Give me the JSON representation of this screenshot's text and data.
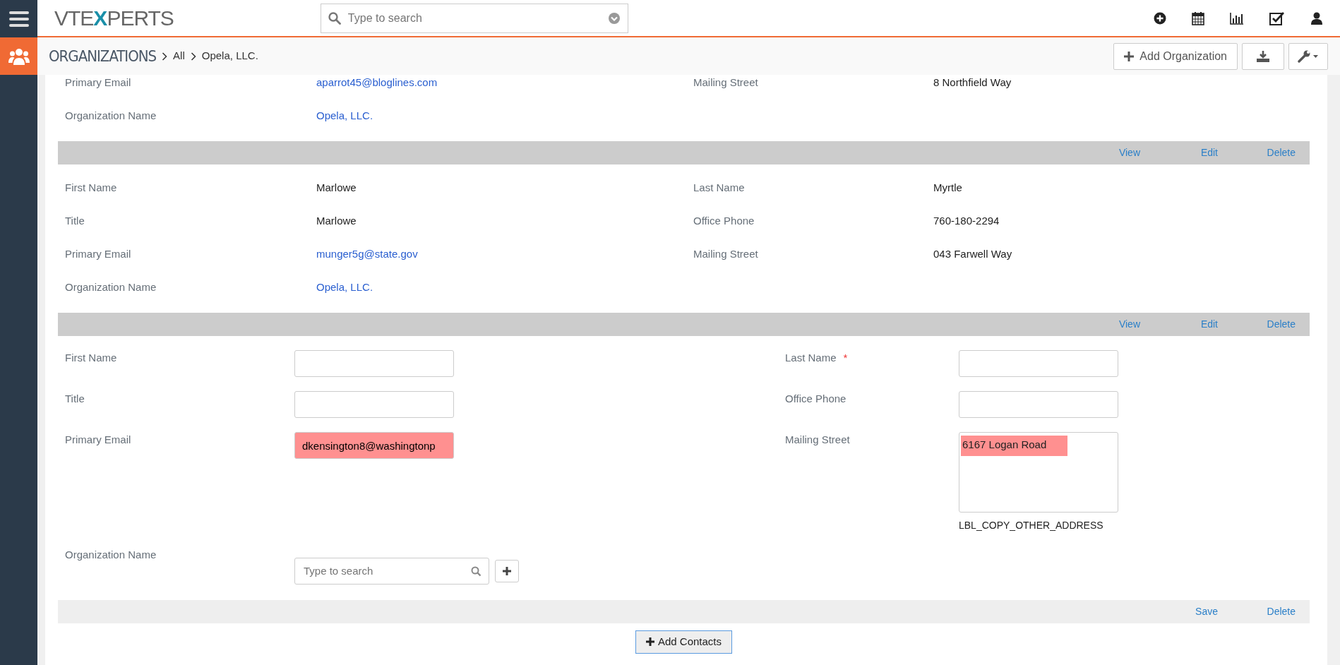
{
  "logo": [
    {
      "text": "VTE",
      "accent": false
    },
    {
      "text": "X",
      "accent": true
    },
    {
      "text": "PERTS",
      "accent": false
    }
  ],
  "search": {
    "placeholder": "Type to search"
  },
  "breadcrumb": {
    "module": "ORGANIZATIONS",
    "items": [
      "All",
      "Opela, LLC."
    ]
  },
  "toolbar": {
    "add_button": "Add Organization"
  },
  "records": [
    {
      "kind": "view",
      "fields": [
        {
          "label": "Primary Email",
          "value": "aparrot45@bloglines.com",
          "link": true
        },
        {
          "label": "Mailing Street",
          "value": "8 Northfield Way",
          "link": false
        },
        {
          "label": "Organization Name",
          "value": "Opela, LLC.",
          "link": true
        }
      ]
    },
    {
      "kind": "view",
      "actions": [
        "View",
        "Edit",
        "Delete"
      ],
      "fields": [
        {
          "label": "First Name",
          "value": "Marlowe",
          "link": false
        },
        {
          "label": "Last Name",
          "value": "Myrtle",
          "link": false
        },
        {
          "label": "Title",
          "value": "Marlowe",
          "link": false
        },
        {
          "label": "Office Phone",
          "value": "760-180-2294",
          "link": false
        },
        {
          "label": "Primary Email",
          "value": "munger5g@state.gov",
          "link": true
        },
        {
          "label": "Mailing Street",
          "value": "043 Farwell Way",
          "link": false
        },
        {
          "label": "Organization Name",
          "value": "Opela, LLC.",
          "link": true
        }
      ]
    },
    {
      "kind": "edit",
      "actions": [
        "View",
        "Edit",
        "Delete"
      ],
      "fields": [
        {
          "label": "First Name",
          "kind": "input",
          "highlighted": false
        },
        {
          "label": "Last Name",
          "kind": "input",
          "required_mark": "*",
          "highlighted": false
        },
        {
          "label": "Title",
          "kind": "input",
          "highlighted": false
        },
        {
          "label": "Office Phone",
          "kind": "input",
          "highlighted": false
        },
        {
          "label": "Primary Email",
          "kind": "input",
          "value": "dkensington8@washingtonp",
          "highlighted": true
        },
        {
          "label": "Mailing Street",
          "kind": "textarea",
          "value": "6167 Logan Road",
          "highlighted": true,
          "note": "LBL_COPY_OTHER_ADDRESS"
        },
        {
          "label": "Organization Name",
          "kind": "lookup",
          "placeholder": "Type to search"
        }
      ]
    },
    {
      "kind": "new",
      "actions": [
        "Save",
        "Delete"
      ]
    }
  ],
  "add_contacts": "Add Contacts"
}
